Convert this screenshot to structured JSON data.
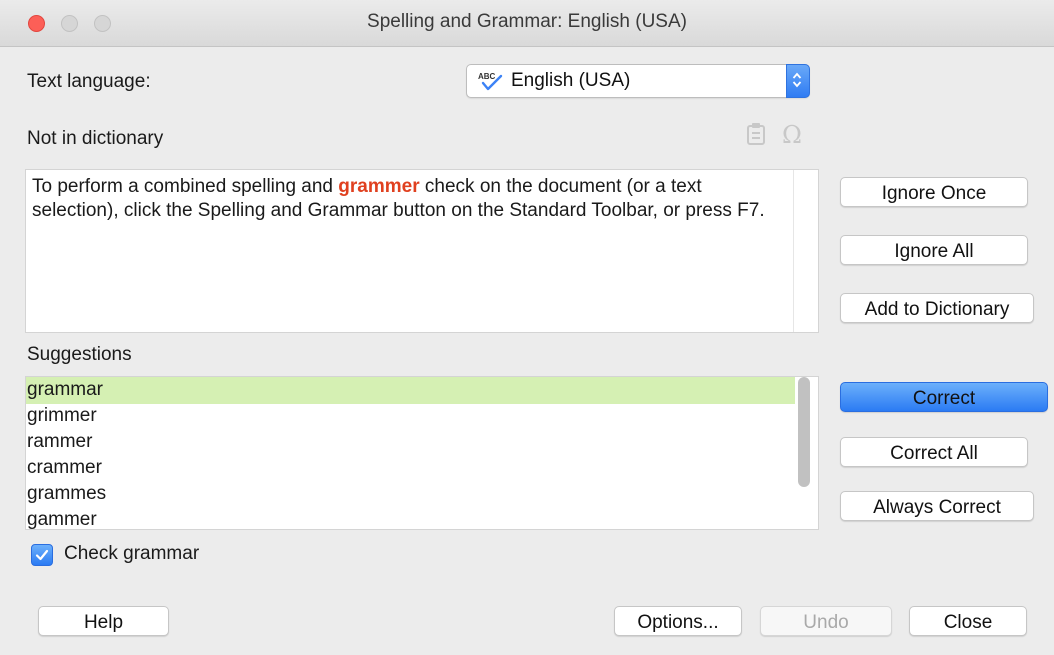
{
  "window": {
    "title": "Spelling and Grammar: English (USA)"
  },
  "language": {
    "label": "Text language:",
    "value": "English (USA)"
  },
  "not_in_dictionary": {
    "label": "Not in dictionary",
    "text_before": "To perform a combined spelling and ",
    "error_word": "grammer",
    "text_after": " check on the document (or a text selection), click the Spelling and Grammar button on the Standard Toolbar, or press F7."
  },
  "suggestions": {
    "label": "Suggestions",
    "items": [
      "grammar",
      "grimmer",
      "rammer",
      "crammer",
      "grammes",
      "gammer"
    ]
  },
  "side_buttons": {
    "ignore_once": "Ignore Once",
    "ignore_all": "Ignore All",
    "add_to_dictionary": "Add to Dictionary",
    "correct": "Correct",
    "correct_all": "Correct All",
    "always_correct": "Always Correct"
  },
  "check_grammar": {
    "label": "Check grammar",
    "checked": true
  },
  "footer": {
    "help": "Help",
    "options": "Options...",
    "undo": "Undo",
    "close": "Close"
  },
  "colors": {
    "error": "#e0401f",
    "selection": "#d5f0b3",
    "accent": "#2b7bf3"
  }
}
